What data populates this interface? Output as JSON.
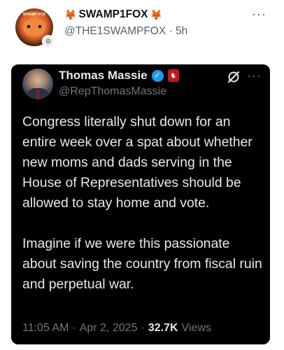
{
  "outer_post": {
    "name_prefix_emoji": "🦊",
    "display_name": "SWAMP1FOX",
    "name_suffix_emoji": "🦊",
    "handle": "@THE1SWAMPFOX",
    "separator": "·",
    "time_ago": "5h",
    "more_label": "···",
    "avatar_text": "SWAMP FOX",
    "avatar_badge_icon": "verified-org-badge-icon"
  },
  "quoted_post": {
    "display_name": "Thomas Massie",
    "handle": "@RepThomasMassie",
    "verified_icon": "verified-check-icon",
    "verified_glyph": "✓",
    "party_badge_icon": "party-affiliation-badge-icon",
    "party_badge_glyph": "♞",
    "grok_icon": "grok-slash-icon",
    "more_label": "···",
    "text": "Congress literally shut down for an entire week over a spat about whether new moms and dads serving in the House of Representatives should be allowed to stay home and vote.\n\nImagine if we were this passionate about saving the country from fiscal ruin and perpetual war.",
    "time": "11:05 AM",
    "dot": "·",
    "date": "Apr 2, 2025",
    "dot2": "·",
    "views_count": "32.7K",
    "views_label": "Views"
  },
  "colors": {
    "accent_blue": "#1d9bf0",
    "party_red": "#c4161c",
    "dark_bg": "#000000",
    "text_light": "#e7e9ea",
    "text_muted": "#71767b"
  }
}
